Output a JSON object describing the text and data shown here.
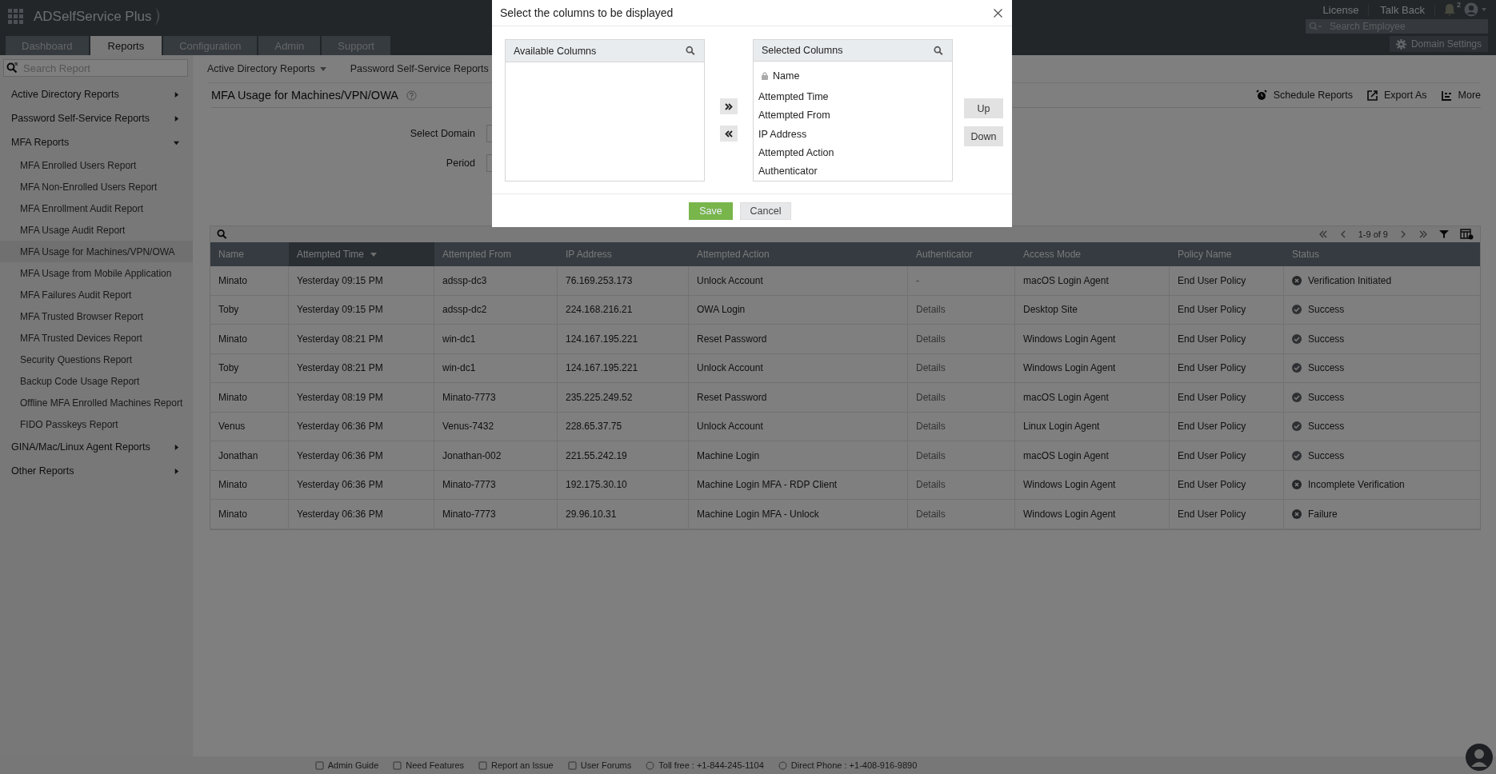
{
  "header": {
    "app_name": "ADSelfService Plus",
    "links": [
      "License",
      "Talk Back"
    ],
    "notification_count": "2",
    "search": {
      "placeholder": "Search Employee"
    },
    "domain_settings": "Domain Settings"
  },
  "tabs": [
    {
      "label": "Dashboard",
      "selected": false
    },
    {
      "label": "Reports",
      "selected": true
    },
    {
      "label": "Configuration",
      "selected": false
    },
    {
      "label": "Admin",
      "selected": false
    },
    {
      "label": "Support",
      "selected": false
    }
  ],
  "sidebar": {
    "search": {
      "placeholder": "Search Report"
    },
    "items": [
      {
        "label": "Active Directory Reports",
        "expanded": false
      },
      {
        "label": "Password Self-Service Reports",
        "expanded": false
      },
      {
        "label": "MFA Reports",
        "expanded": true,
        "children": [
          {
            "label": "MFA Enrolled Users Report",
            "selected": false
          },
          {
            "label": "MFA Non-Enrolled Users Report",
            "selected": false
          },
          {
            "label": "MFA Enrollment Audit Report",
            "selected": false
          },
          {
            "label": "MFA Usage Audit Report",
            "selected": false
          },
          {
            "label": "MFA Usage for Machines/VPN/OWA",
            "selected": true
          },
          {
            "label": "MFA Usage from Mobile Application",
            "selected": false
          },
          {
            "label": "MFA Failures Audit Report",
            "selected": false
          },
          {
            "label": "MFA Trusted Browser Report",
            "selected": false
          },
          {
            "label": "MFA Trusted Devices Report",
            "selected": false
          },
          {
            "label": "Security Questions Report",
            "selected": false
          },
          {
            "label": "Backup Code Usage Report",
            "selected": false
          },
          {
            "label": "Offline MFA Enrolled Machines Report",
            "selected": false
          },
          {
            "label": "FIDO Passkeys Report",
            "selected": false
          }
        ]
      },
      {
        "label": "GINA/Mac/Linux Agent Reports",
        "expanded": false
      },
      {
        "label": "Other Reports",
        "expanded": false
      }
    ]
  },
  "subnav": [
    "Active Directory Reports",
    "Password Self-Service Reports"
  ],
  "report": {
    "title": "MFA Usage for Machines/VPN/OWA",
    "actions": [
      "Schedule Reports",
      "Export As",
      "More"
    ],
    "filters": [
      "Select Domain",
      "Period"
    ]
  },
  "table": {
    "pagination": "1-9 of 9",
    "columns": [
      {
        "label": "Name",
        "sorted": false
      },
      {
        "label": "Attempted Time",
        "sorted": true
      },
      {
        "label": "Attempted From",
        "sorted": false
      },
      {
        "label": "IP Address",
        "sorted": false
      },
      {
        "label": "Attempted Action",
        "sorted": false
      },
      {
        "label": "Authenticator",
        "sorted": false
      },
      {
        "label": "Access Mode",
        "sorted": false
      },
      {
        "label": "Policy Name",
        "sorted": false
      },
      {
        "label": "Status",
        "sorted": false
      }
    ],
    "rows": [
      {
        "cells": [
          "Minato",
          "Yesterday 09:15 PM",
          "adssp-dc3",
          "76.169.253.173",
          "Unlock Account",
          "-",
          "macOS Login Agent",
          "End User Policy"
        ],
        "status": "Verification Initiated",
        "ok": false
      },
      {
        "cells": [
          "Toby",
          "Yesterday 09:15 PM",
          "adssp-dc2",
          "224.168.216.21",
          "OWA Login",
          "Details",
          "Desktop Site",
          "End User Policy"
        ],
        "status": "Success",
        "ok": true
      },
      {
        "cells": [
          "Minato",
          "Yesterday 08:21 PM",
          "win-dc1",
          "124.167.195.221",
          "Reset Password",
          "Details",
          "Windows Login Agent",
          "End User Policy"
        ],
        "status": "Success",
        "ok": true
      },
      {
        "cells": [
          "Toby",
          "Yesterday 08:21 PM",
          "win-dc1",
          "124.167.195.221",
          "Unlock Account",
          "Details",
          "Windows Login Agent",
          "End User Policy"
        ],
        "status": "Success",
        "ok": true
      },
      {
        "cells": [
          "Minato",
          "Yesterday 08:19 PM",
          "Minato-7773",
          "235.225.249.52",
          "Reset Password",
          "Details",
          "macOS Login Agent",
          "End User Policy"
        ],
        "status": "Success",
        "ok": true
      },
      {
        "cells": [
          "Venus",
          "Yesterday 06:36 PM",
          "Venus-7432",
          "228.65.37.75",
          "Unlock Account",
          "Details",
          "Linux Login Agent",
          "End User Policy"
        ],
        "status": "Success",
        "ok": true
      },
      {
        "cells": [
          "Jonathan",
          "Yesterday 06:36 PM",
          "Jonathan-002",
          "221.55.242.19",
          "Machine Login",
          "Details",
          "macOS Login Agent",
          "End User Policy"
        ],
        "status": "Success",
        "ok": true
      },
      {
        "cells": [
          "Minato",
          "Yesterday 06:36 PM",
          "Minato-7773",
          "192.175.30.10",
          "Machine Login MFA - RDP Client",
          "Details",
          "Windows Login Agent",
          "End User Policy"
        ],
        "status": "Incomplete Verification",
        "ok": false
      },
      {
        "cells": [
          "Minato",
          "Yesterday 06:36 PM",
          "Minato-7773",
          "29.96.10.31",
          "Machine Login MFA - Unlock",
          "Details",
          "Windows Login Agent",
          "End User Policy"
        ],
        "status": "Failure",
        "ok": false
      }
    ]
  },
  "footer": [
    "Admin Guide",
    "Need Features",
    "Report an Issue",
    "User Forums",
    "Toll free : +1-844-245-1104",
    "Direct Phone : +1-408-916-9890"
  ],
  "dialog": {
    "title": "Select the columns to be displayed",
    "available_title": "Available Columns",
    "selected_title": "Selected Columns",
    "selected_items": [
      {
        "label": "Name",
        "locked": true
      },
      {
        "label": "Attempted Time",
        "locked": false
      },
      {
        "label": "Attempted From",
        "locked": false
      },
      {
        "label": "IP Address",
        "locked": false
      },
      {
        "label": "Attempted Action",
        "locked": false
      },
      {
        "label": "Authenticator",
        "locked": false
      }
    ],
    "order_buttons": [
      "Up",
      "Down"
    ],
    "save": "Save",
    "cancel": "Cancel"
  }
}
